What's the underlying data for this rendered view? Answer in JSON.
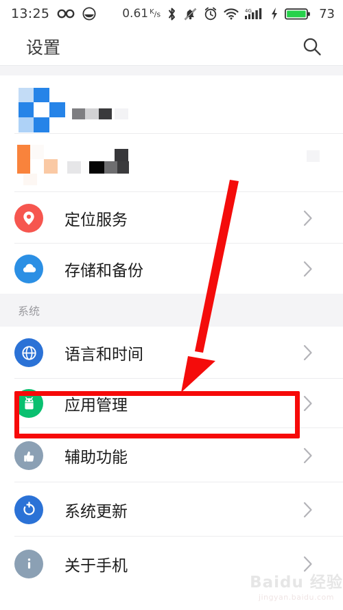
{
  "statusbar": {
    "clock": "13:25",
    "icons_left": [
      "infinity-icon",
      "smiley-face-icon"
    ],
    "data_rate": "0.61",
    "data_rate_unit_top": "K",
    "data_rate_unit_bottom": "s",
    "icons_right": [
      "bluetooth-icon",
      "mute-bell-icon",
      "alarm-clock-icon",
      "wifi-icon",
      "signal-4g-icon",
      "charging-bolt-icon",
      "battery-icon"
    ],
    "network_label": "4G",
    "battery_percent": "73"
  },
  "header": {
    "title": "设置",
    "search_icon": "search-icon"
  },
  "list": {
    "redacted_rows": [
      {
        "name": "redacted-row-1",
        "icon_color": "#2684e8"
      },
      {
        "name": "redacted-row-2",
        "icon_color": "#f98031"
      }
    ],
    "items": [
      {
        "label": "定位服务",
        "icon": "location-pin-icon",
        "icon_bg": "#f6564f",
        "chevron": "chevron-right-icon",
        "highlighted": false
      },
      {
        "label": "存储和备份",
        "icon": "cloud-icon",
        "icon_bg": "#2b8fe4",
        "chevron": "chevron-right-icon",
        "highlighted": false
      }
    ],
    "section_header": "系统",
    "system_items": [
      {
        "label": "语言和时间",
        "icon": "globe-icon",
        "icon_bg": "#2b72d6",
        "chevron": "chevron-right-icon",
        "highlighted": false
      },
      {
        "label": "应用管理",
        "icon": "android-robot-icon",
        "icon_bg": "#0ac070",
        "chevron": "chevron-right-icon",
        "highlighted": true
      },
      {
        "label": "辅助功能",
        "icon": "thumb-hand-icon",
        "icon_bg": "#8ba0b4",
        "chevron": "chevron-right-icon",
        "highlighted": false
      },
      {
        "label": "系统更新",
        "icon": "refresh-icon",
        "icon_bg": "#2b72d6",
        "chevron": "chevron-right-icon",
        "highlighted": false
      },
      {
        "label": "关于手机",
        "icon": "info-icon",
        "icon_bg": "#8ba0b4",
        "chevron": "chevron-right-icon",
        "highlighted": false
      }
    ]
  },
  "annotations": {
    "highlight_color": "#f60a09",
    "arrow_color": "#f40c0b",
    "arrow_name": "red-pointer-arrow",
    "highlight_target": "应用管理"
  },
  "watermark": {
    "main": "Baidu 经验",
    "sub": "jingyan.baidu.com"
  }
}
